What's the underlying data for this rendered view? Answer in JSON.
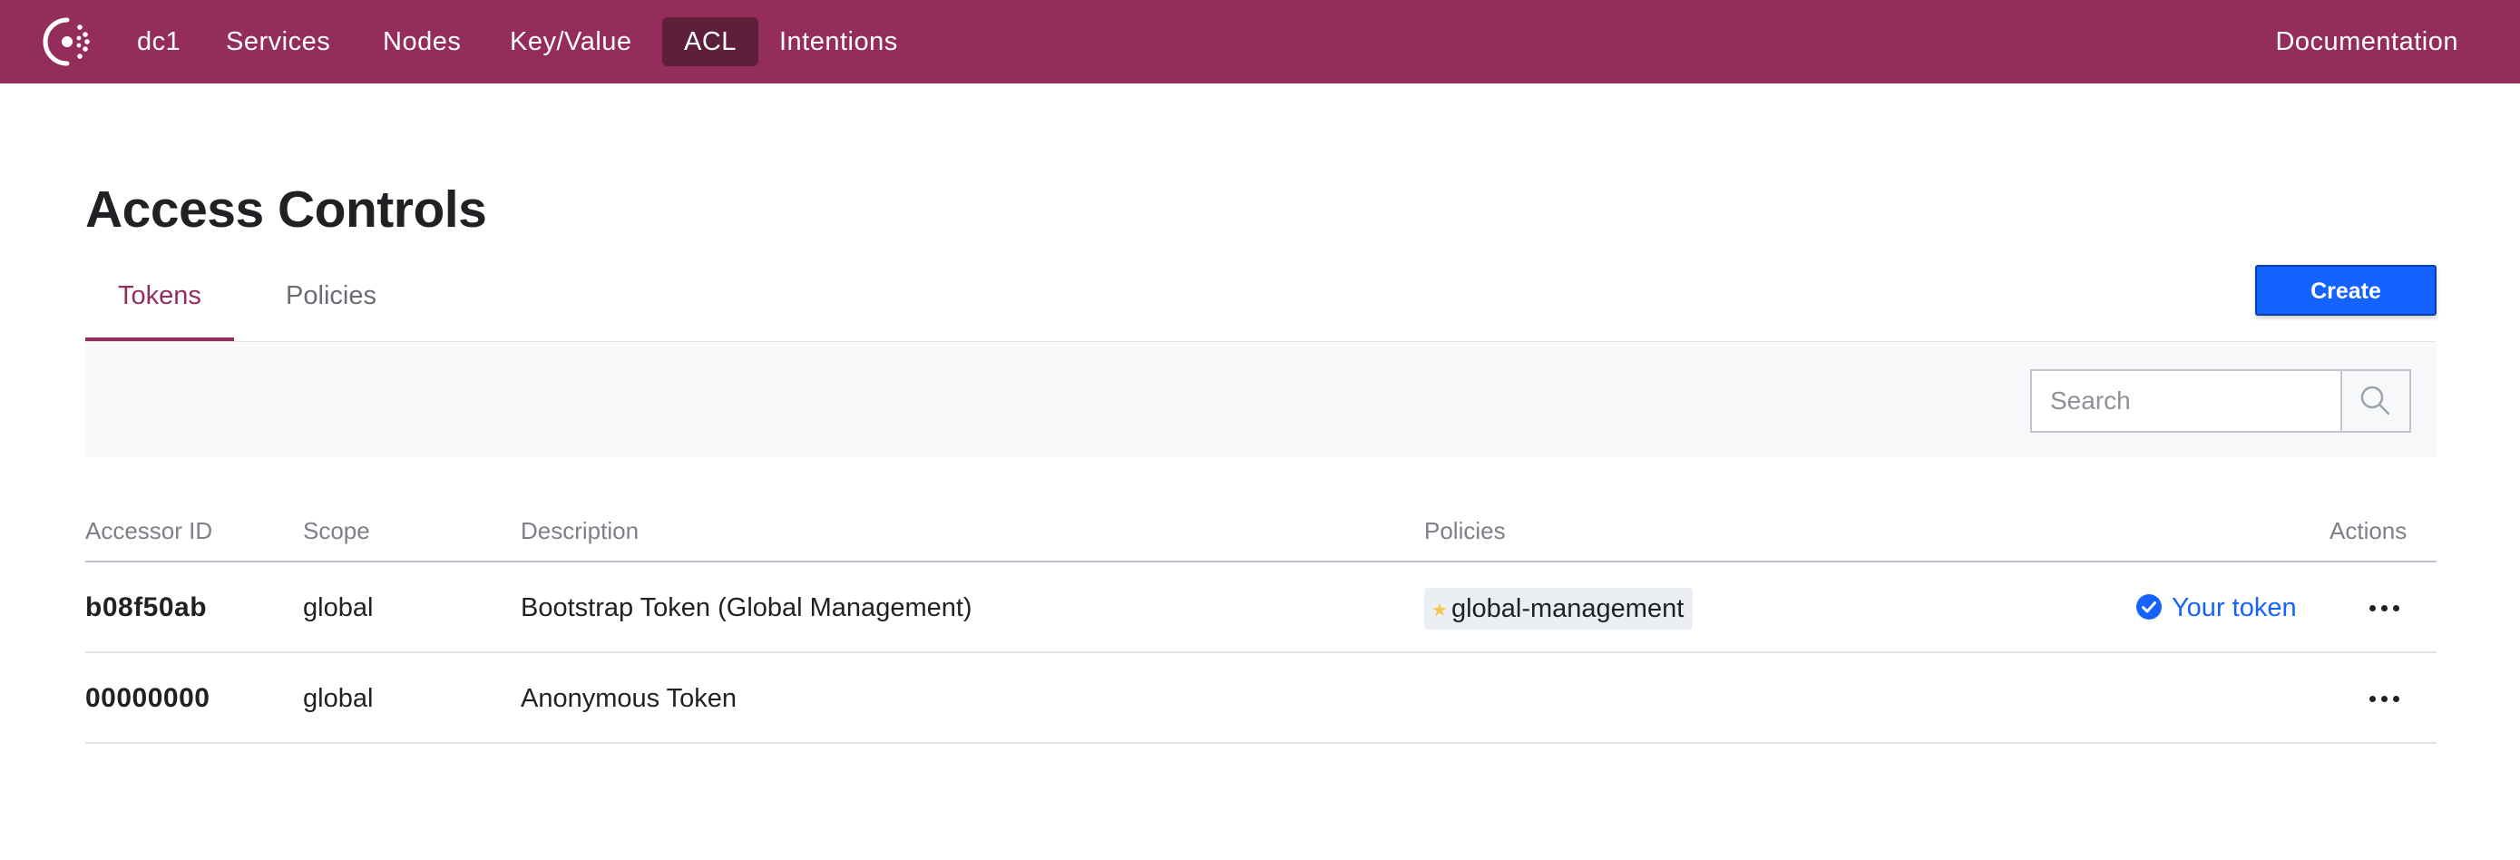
{
  "nav": {
    "logo_icon": "consul-logo-icon",
    "items": [
      {
        "label": "dc1"
      },
      {
        "label": "Services"
      },
      {
        "label": "Nodes"
      },
      {
        "label": "Key/Value"
      },
      {
        "label": "ACL",
        "active": true
      },
      {
        "label": "Intentions"
      }
    ],
    "documentation_label": "Documentation"
  },
  "page": {
    "title": "Access Controls",
    "tabs": [
      {
        "label": "Tokens",
        "active": true
      },
      {
        "label": "Policies",
        "active": false
      }
    ],
    "create_label": "Create"
  },
  "search": {
    "placeholder": "Search",
    "value": "",
    "icon": "search-icon"
  },
  "table": {
    "headers": {
      "accessor_id": "Accessor ID",
      "scope": "Scope",
      "description": "Description",
      "policies": "Policies",
      "actions": "Actions"
    },
    "rows": [
      {
        "accessor_id": "b08f50ab",
        "scope": "global",
        "description": "Bootstrap Token (Global Management)",
        "policy": "global-management",
        "policy_icon": "star-icon",
        "your_token_label": "Your token",
        "your_token_icon": "check-circle-icon"
      },
      {
        "accessor_id": "00000000",
        "scope": "global",
        "description": "Anonymous Token"
      }
    ]
  },
  "colors": {
    "brand": "#942d5b",
    "brand_dark": "#5e1f38",
    "primary_button": "#1563ff",
    "link": "#1563ff",
    "star": "#f2c94c"
  }
}
